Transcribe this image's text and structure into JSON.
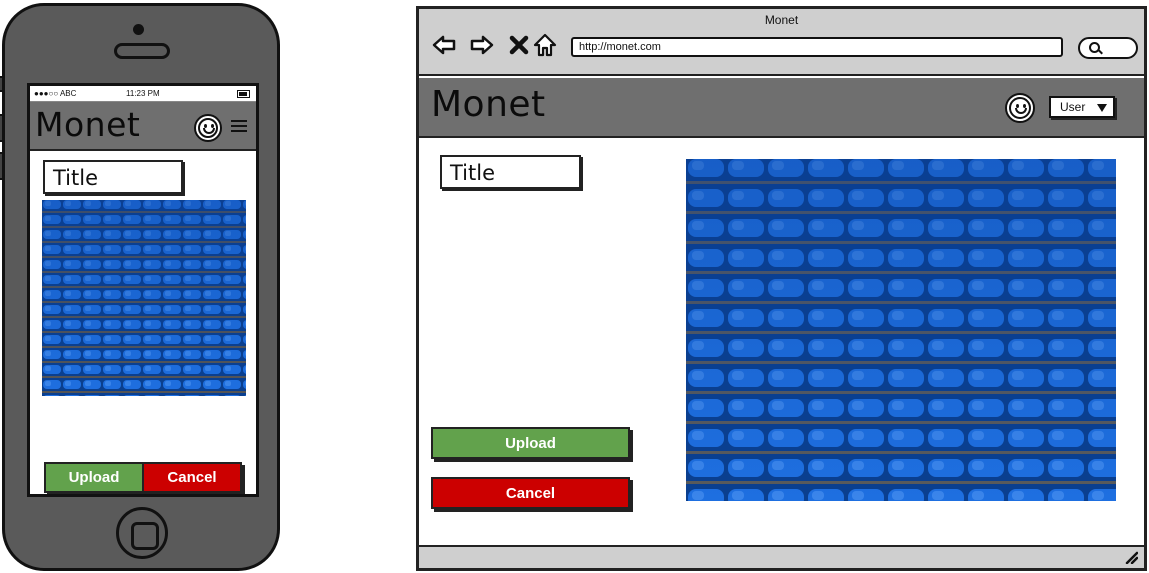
{
  "colors": {
    "header_gray": "#6f6f6f",
    "chrome_gray": "#cfcfcf",
    "upload_green": "#62a24c",
    "cancel_red": "#cc0000",
    "seat_blue": "#0b57c2"
  },
  "phone": {
    "status": {
      "carrier": "●●●○○ ABC",
      "time": "11:23 PM"
    },
    "header": {
      "title": "Monet",
      "icons": [
        "smiley-icon",
        "hamburger-menu-icon"
      ]
    },
    "form": {
      "title_field": "Title",
      "image": "stadium-seats-photo",
      "upload_label": "Upload",
      "cancel_label": "Cancel"
    }
  },
  "browser": {
    "window_title": "Monet",
    "nav_icons": [
      "back-arrow-icon",
      "forward-arrow-icon",
      "stop-icon",
      "home-icon"
    ],
    "url": "http://monet.com",
    "app_header": {
      "title": "Monet",
      "user_select": "User"
    },
    "form": {
      "title_field": "Title",
      "image": "stadium-seats-photo",
      "upload_label": "Upload",
      "cancel_label": "Cancel"
    }
  }
}
